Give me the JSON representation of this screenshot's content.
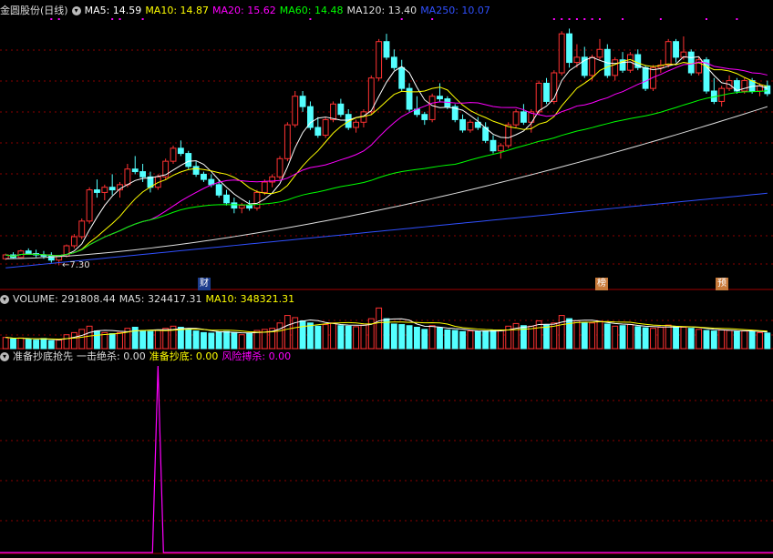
{
  "price_header": {
    "stock": "金圆股份(日线)",
    "ma": [
      {
        "label": "MA5: 14.59",
        "color": "#ffffff"
      },
      {
        "label": "MA10: 14.87",
        "color": "#ffff00"
      },
      {
        "label": "MA20: 15.62",
        "color": "#ff00ff"
      },
      {
        "label": "MA60: 14.48",
        "color": "#00ff00"
      },
      {
        "label": "MA120: 13.40",
        "color": "#dddddd"
      },
      {
        "label": "MA250: 10.07",
        "color": "#3050ff"
      }
    ]
  },
  "volume_header": {
    "label": "VOLUME: 291808.44",
    "ma5": "MA5: 324417.31",
    "ma10": "MA10: 348321.31"
  },
  "indicator_header": {
    "name": "准备抄底抢先",
    "s1": "一击绝杀: 0.00",
    "s2": "准备抄底: 0.00",
    "s3": "风险搏杀: 0.00"
  },
  "colors": {
    "up": "#ff3232",
    "down": "#54ffff",
    "grid": "#8b0000",
    "pink": "#ff00ff"
  },
  "annotations": {
    "low_marker": "←7.30",
    "tags": [
      {
        "text": "财",
        "style": "blue"
      },
      {
        "text": "榜",
        "style": "orange"
      },
      {
        "text": "预",
        "style": "orange"
      }
    ]
  },
  "chart_data": {
    "type": "candlestick",
    "ohlc": [
      [
        7.55,
        7.75,
        7.5,
        7.7
      ],
      [
        7.7,
        7.8,
        7.55,
        7.6
      ],
      [
        7.6,
        7.9,
        7.58,
        7.85
      ],
      [
        7.85,
        7.95,
        7.7,
        7.75
      ],
      [
        7.75,
        7.9,
        7.6,
        7.7
      ],
      [
        7.7,
        7.85,
        7.55,
        7.65
      ],
      [
        7.65,
        7.8,
        7.4,
        7.5
      ],
      [
        7.5,
        7.7,
        7.3,
        7.65
      ],
      [
        7.65,
        8.1,
        7.6,
        8.05
      ],
      [
        8.05,
        8.5,
        7.95,
        8.4
      ],
      [
        8.4,
        9.1,
        8.3,
        9.0
      ],
      [
        9.0,
        10.3,
        8.9,
        10.2
      ],
      [
        10.2,
        10.6,
        9.9,
        10.1
      ],
      [
        10.1,
        10.4,
        9.8,
        10.3
      ],
      [
        10.3,
        10.8,
        10.0,
        10.2
      ],
      [
        10.2,
        10.5,
        9.9,
        10.4
      ],
      [
        10.4,
        11.2,
        10.3,
        11.0
      ],
      [
        11.0,
        11.5,
        10.8,
        10.9
      ],
      [
        10.9,
        11.2,
        10.5,
        10.7
      ],
      [
        10.7,
        10.9,
        10.1,
        10.3
      ],
      [
        10.3,
        10.8,
        10.2,
        10.7
      ],
      [
        10.7,
        11.4,
        10.6,
        11.3
      ],
      [
        11.3,
        11.9,
        11.2,
        11.8
      ],
      [
        11.8,
        12.1,
        11.5,
        11.6
      ],
      [
        11.6,
        11.7,
        11.0,
        11.1
      ],
      [
        11.1,
        11.3,
        10.7,
        10.8
      ],
      [
        10.8,
        10.9,
        10.5,
        10.6
      ],
      [
        10.6,
        10.8,
        10.3,
        10.4
      ],
      [
        10.4,
        10.6,
        9.9,
        10.0
      ],
      [
        10.0,
        10.2,
        9.6,
        9.7
      ],
      [
        9.7,
        9.9,
        9.3,
        9.5
      ],
      [
        9.5,
        9.7,
        9.3,
        9.6
      ],
      [
        9.6,
        9.8,
        9.4,
        9.5
      ],
      [
        9.5,
        10.2,
        9.4,
        10.1
      ],
      [
        10.1,
        10.6,
        10.0,
        10.5
      ],
      [
        10.5,
        10.8,
        10.3,
        10.7
      ],
      [
        10.7,
        11.5,
        10.6,
        11.4
      ],
      [
        11.4,
        12.8,
        11.3,
        12.7
      ],
      [
        12.7,
        14.0,
        12.6,
        13.8
      ],
      [
        13.8,
        14.0,
        13.2,
        13.4
      ],
      [
        13.4,
        13.6,
        12.5,
        12.6
      ],
      [
        12.6,
        13.0,
        12.2,
        12.3
      ],
      [
        12.3,
        13.0,
        12.2,
        12.9
      ],
      [
        12.9,
        13.6,
        12.8,
        13.5
      ],
      [
        13.5,
        13.7,
        13.0,
        13.1
      ],
      [
        13.1,
        13.3,
        12.5,
        12.6
      ],
      [
        12.6,
        12.9,
        12.4,
        12.8
      ],
      [
        12.8,
        13.3,
        12.6,
        13.2
      ],
      [
        13.2,
        14.6,
        13.1,
        14.5
      ],
      [
        14.5,
        16.0,
        14.4,
        15.9
      ],
      [
        15.9,
        16.2,
        15.2,
        15.3
      ],
      [
        15.3,
        15.6,
        14.8,
        14.9
      ],
      [
        14.9,
        15.2,
        14.0,
        14.1
      ],
      [
        14.1,
        14.3,
        13.2,
        13.3
      ],
      [
        13.3,
        13.8,
        13.0,
        13.1
      ],
      [
        13.1,
        13.2,
        12.7,
        12.9
      ],
      [
        12.9,
        13.9,
        12.8,
        13.8
      ],
      [
        13.8,
        14.3,
        13.6,
        13.7
      ],
      [
        13.7,
        13.8,
        13.3,
        13.4
      ],
      [
        13.4,
        13.5,
        12.8,
        12.9
      ],
      [
        12.9,
        13.1,
        12.4,
        12.5
      ],
      [
        12.5,
        12.9,
        12.4,
        12.8
      ],
      [
        12.8,
        13.0,
        12.5,
        12.6
      ],
      [
        12.6,
        12.8,
        12.0,
        12.1
      ],
      [
        12.1,
        12.3,
        11.6,
        11.7
      ],
      [
        11.7,
        12.0,
        11.4,
        11.9
      ],
      [
        11.9,
        12.8,
        11.8,
        12.7
      ],
      [
        12.7,
        13.3,
        12.6,
        13.2
      ],
      [
        13.2,
        13.5,
        12.7,
        12.8
      ],
      [
        12.8,
        13.3,
        12.4,
        13.2
      ],
      [
        13.2,
        14.4,
        13.1,
        14.3
      ],
      [
        14.3,
        14.5,
        13.5,
        13.6
      ],
      [
        13.6,
        14.8,
        13.5,
        14.7
      ],
      [
        14.7,
        16.3,
        14.6,
        16.2
      ],
      [
        16.2,
        16.4,
        14.9,
        15.1
      ],
      [
        15.1,
        15.8,
        14.9,
        15.3
      ],
      [
        15.3,
        15.7,
        14.5,
        14.6
      ],
      [
        14.6,
        15.4,
        14.4,
        15.3
      ],
      [
        15.3,
        16.0,
        15.2,
        15.6
      ],
      [
        15.6,
        15.8,
        14.5,
        14.6
      ],
      [
        14.6,
        15.3,
        14.4,
        15.2
      ],
      [
        15.2,
        15.5,
        14.7,
        14.8
      ],
      [
        14.8,
        15.5,
        14.7,
        15.4
      ],
      [
        15.4,
        15.6,
        14.8,
        14.9
      ],
      [
        14.9,
        15.0,
        14.0,
        14.1
      ],
      [
        14.1,
        15.0,
        14.0,
        14.9
      ],
      [
        14.9,
        15.2,
        14.7,
        15.0
      ],
      [
        15.0,
        16.0,
        14.9,
        15.9
      ],
      [
        15.9,
        16.0,
        15.1,
        15.3
      ],
      [
        15.3,
        16.1,
        15.2,
        15.5
      ],
      [
        15.5,
        15.6,
        14.6,
        14.7
      ],
      [
        14.7,
        15.3,
        14.6,
        15.2
      ],
      [
        15.2,
        15.3,
        13.9,
        14.0
      ],
      [
        14.0,
        14.5,
        13.5,
        13.6
      ],
      [
        13.6,
        14.2,
        13.4,
        14.1
      ],
      [
        14.1,
        14.6,
        14.0,
        14.4
      ],
      [
        14.4,
        14.5,
        13.9,
        14.0
      ],
      [
        14.0,
        14.5,
        13.9,
        14.4
      ],
      [
        14.4,
        14.5,
        13.9,
        14.0
      ],
      [
        14.0,
        14.3,
        13.8,
        14.2
      ],
      [
        14.2,
        14.4,
        13.8,
        13.9
      ]
    ],
    "volume": [
      210000,
      180000,
      200000,
      170000,
      160000,
      190000,
      150000,
      160000,
      260000,
      300000,
      360000,
      420000,
      330000,
      300000,
      280000,
      300000,
      380000,
      400000,
      330000,
      320000,
      340000,
      380000,
      420000,
      400000,
      360000,
      330000,
      300000,
      290000,
      310000,
      320000,
      300000,
      260000,
      280000,
      340000,
      360000,
      380000,
      480000,
      620000,
      580000,
      520000,
      480000,
      420000,
      450000,
      480000,
      430000,
      420000,
      410000,
      440000,
      560000,
      760000,
      560000,
      460000,
      450000,
      430000,
      400000,
      360000,
      430000,
      390000,
      350000,
      340000,
      320000,
      330000,
      320000,
      330000,
      340000,
      340000,
      420000,
      470000,
      430000,
      420000,
      520000,
      440000,
      480000,
      620000,
      560000,
      520000,
      480000,
      480000,
      510000,
      460000,
      420000,
      430000,
      450000,
      410000,
      390000,
      380000,
      400000,
      440000,
      410000,
      400000,
      380000,
      360000,
      340000,
      330000,
      350000,
      340000,
      320000,
      330000,
      320000,
      300000,
      291808
    ],
    "indicator": {
      "spike_index": 20,
      "spike_value": 1.0
    },
    "ylim_price": [
      7.0,
      16.8
    ]
  }
}
